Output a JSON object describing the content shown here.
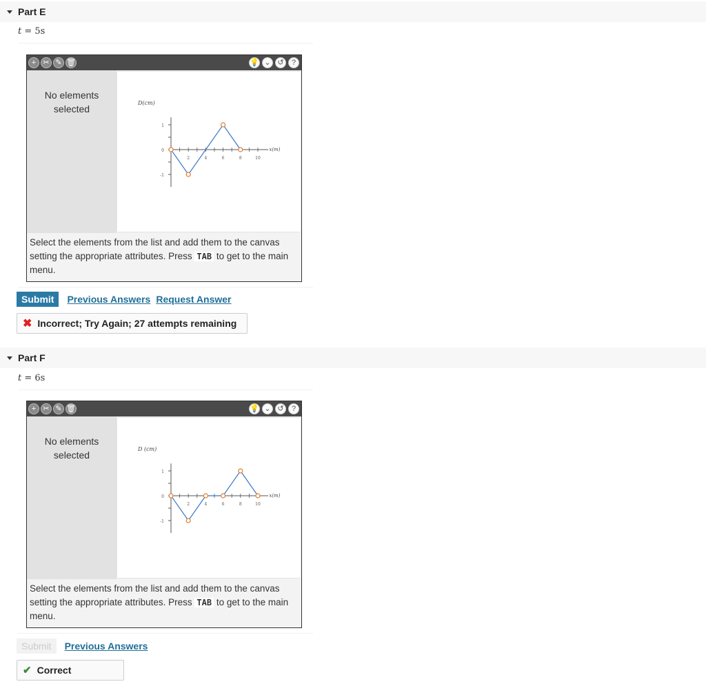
{
  "parts": [
    {
      "title": "Part E",
      "t_label": "t",
      "t_value": " = 5s",
      "panel_message": "No elements selected",
      "graph": {
        "ylabel": "D(cm)",
        "xlabel": "x(m)",
        "y_ticks": [
          "1",
          "0",
          "-1"
        ],
        "x_ticks": [
          "2",
          "4",
          "6",
          "8",
          "10"
        ]
      },
      "instructions_pre": "Select the elements from the list and add them to the canvas setting the appropriate attributes. Press",
      "instructions_key": "TAB",
      "instructions_post": "to get to the main menu.",
      "submit_label": "Submit",
      "links": [
        "Previous Answers",
        "Request Answer"
      ],
      "feedback": "Incorrect; Try Again; 27 attempts remaining"
    },
    {
      "title": "Part F",
      "t_label": "t",
      "t_value": " = 6s",
      "panel_message": "No elements selected",
      "graph": {
        "ylabel": "D (cm)",
        "xlabel": "x(m)",
        "y_ticks": [
          "1",
          "0",
          "-1"
        ],
        "x_ticks": [
          "2",
          "4",
          "6",
          "8",
          "10"
        ]
      },
      "instructions_pre": "Select the elements from the list and add them to the canvas setting the appropriate attributes. Press",
      "instructions_key": "TAB",
      "instructions_post": "to get to the main menu.",
      "submit_label": "Submit",
      "links": [
        "Previous Answers"
      ],
      "feedback": "Correct"
    }
  ],
  "chart_data": [
    {
      "type": "line",
      "xlabel": "x(m)",
      "ylabel": "D(cm)",
      "xlim": [
        0,
        10
      ],
      "ylim": [
        -1,
        1
      ],
      "x": [
        0,
        2,
        6,
        8
      ],
      "y": [
        0,
        -1,
        1,
        0
      ]
    },
    {
      "type": "line",
      "xlabel": "x(m)",
      "ylabel": "D (cm)",
      "xlim": [
        0,
        10
      ],
      "ylim": [
        -1,
        1
      ],
      "x": [
        0,
        2,
        4,
        6,
        8,
        10
      ],
      "y": [
        0,
        -1,
        0,
        0,
        1,
        0
      ]
    }
  ],
  "colors": {
    "line": "#3b74c6",
    "marker": "#e07a2e",
    "submit": "#2b7aa5",
    "link": "#1f6f99"
  }
}
